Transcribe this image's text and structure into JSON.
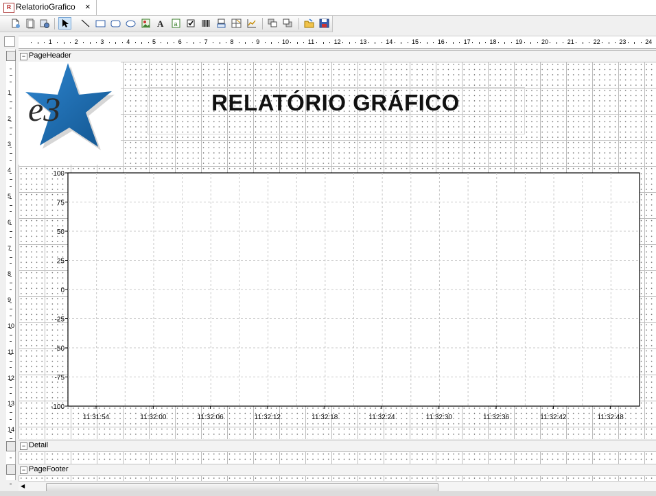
{
  "tab": {
    "title": "RelatorioGrafico",
    "close": "×",
    "icon_text": "R"
  },
  "toolbar": {
    "buttons": [
      "new-report-icon",
      "page-setup-icon",
      "settings-icon",
      "pointer-icon",
      "line-icon",
      "rectangle-icon",
      "rounded-rectangle-icon",
      "ellipse-icon",
      "image-icon",
      "text-icon",
      "field-icon",
      "checkbox-icon",
      "barcode-icon",
      "subreport-icon",
      "table-icon",
      "chart-icon",
      "bring-to-front-icon",
      "send-to-back-icon",
      "open-icon",
      "save-icon"
    ],
    "selected": "pointer-icon"
  },
  "rulers": {
    "horizontal": [
      "1",
      "2",
      "3",
      "4",
      "5",
      "6",
      "7",
      "8",
      "9",
      "10",
      "11",
      "12",
      "13",
      "14",
      "15",
      "16",
      "17",
      "18",
      "19",
      "20",
      "21",
      "22",
      "23",
      "24"
    ],
    "vertical": [
      "1",
      "2",
      "3",
      "4",
      "5",
      "6",
      "7",
      "8",
      "9",
      "10",
      "11",
      "12",
      "13",
      "14"
    ]
  },
  "bands": {
    "page_header": "PageHeader",
    "detail": "Detail",
    "page_footer": "PageFooter",
    "toggle": "⊟"
  },
  "header": {
    "title": "RELATÓRIO GRÁFICO"
  },
  "logo": {
    "text": "e3",
    "star_color": "#1f6fb3"
  },
  "chart_data": {
    "type": "line",
    "x_ticks": [
      "11:31:54",
      "11:32:00",
      "11:32:06",
      "11:32:12",
      "11:32:18",
      "11:32:24",
      "11:32:30",
      "11:32:36",
      "11:32:42",
      "11:32:48"
    ],
    "y_ticks": [
      "100",
      "75",
      "50",
      "25",
      "0",
      "-25",
      "-50",
      "-75",
      "-100"
    ],
    "ylim": [
      -100,
      100
    ],
    "series": [],
    "grid": true
  }
}
